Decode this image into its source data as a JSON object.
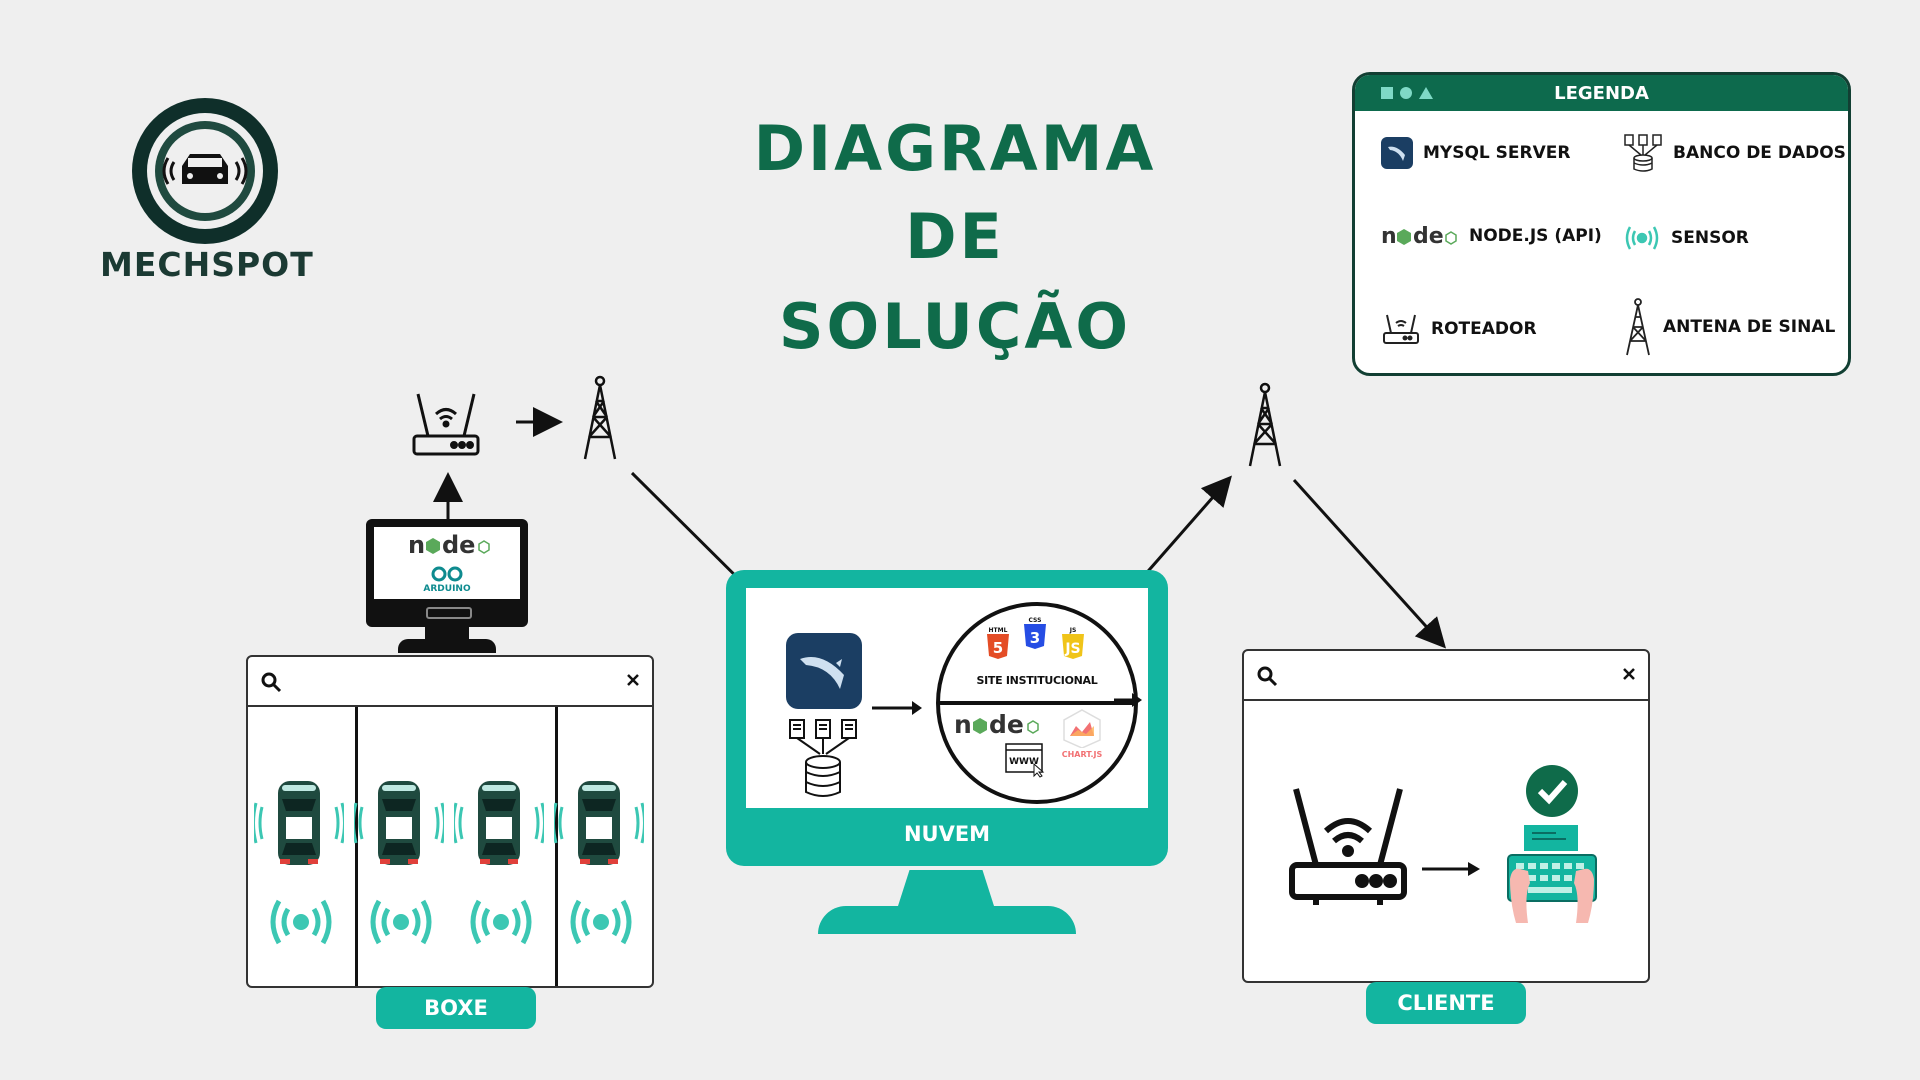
{
  "logo": {
    "text": "MECHSPOT"
  },
  "title": {
    "line1": "DIAGRAMA",
    "line2": "DE",
    "line3": "SOLUÇÃO"
  },
  "legend": {
    "header": "LEGENDA",
    "items": [
      {
        "label": "MYSQL SERVER",
        "icon": "mysql-icon"
      },
      {
        "label": "BANCO DE DADOS",
        "icon": "database-icon"
      },
      {
        "label": "NODE.JS (API)",
        "icon": "nodejs-logo"
      },
      {
        "label": "SENSOR",
        "icon": "sensor-icon"
      },
      {
        "label": "ROTEADOR",
        "icon": "router-icon"
      },
      {
        "label": "ANTENA DE SINAL",
        "icon": "antenna-icon"
      }
    ]
  },
  "arduino_monitor": {
    "node_text": "node",
    "arduino_label": "ARDUINO"
  },
  "cloud": {
    "label": "NUVEM",
    "site_label": "SITE INSTITUCIONAL",
    "node_text": "node",
    "chart_label": "CHART.JS",
    "www_label": "WWW",
    "badges": [
      "HTML",
      "CSS",
      "JS"
    ]
  },
  "boxe": {
    "label": "BOXE",
    "cars": 4
  },
  "cliente": {
    "label": "CLIENTE"
  },
  "colors": {
    "teal": "#13b5a0",
    "dark_green": "#0f6b4a",
    "car_body": "#1f4a3f",
    "sensor": "#3cc7b3"
  }
}
